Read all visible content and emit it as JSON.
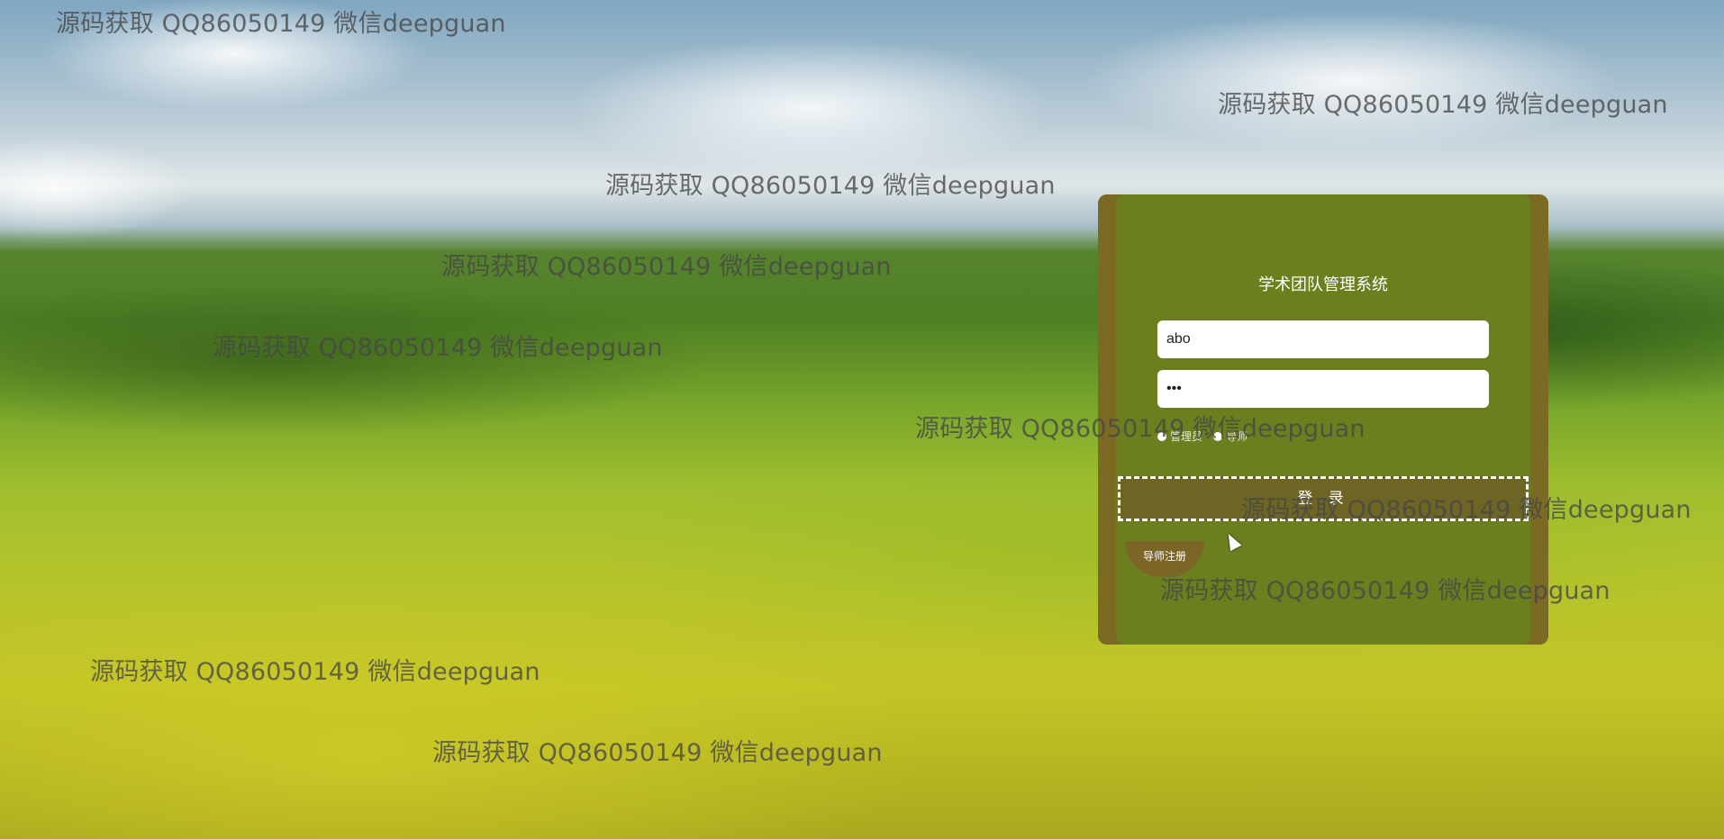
{
  "login": {
    "title": "学术团队管理系统",
    "username_value": "abo",
    "password_value": "•••",
    "roles": [
      "管理员",
      "导师"
    ],
    "login_label": "登 录",
    "register_label": "导师注册"
  },
  "watermarks": [
    "源码获取 QQ86050149 微信deepguan",
    "源码获取 QQ86050149 微信deepguan",
    "源码获取 QQ86050149 微信deepguan",
    "源码获取 QQ86050149 微信deepguan",
    "源码获取 QQ86050149 微信deepguan",
    "源码获取 QQ86050149 微信deepguan",
    "源码获取 QQ86050149 微信deepguan",
    "源码获取 QQ86050149 微信deepguan",
    "源码获取 QQ86050149 微信deepguan",
    "源码获取 QQ86050149 微信deepguan"
  ],
  "colors": {
    "panel": "#6b7f1e",
    "panel_edge": "#7a6a24",
    "button": "#6e6525"
  },
  "icons": [
    "mouse-pointer-icon",
    "radio-icon"
  ]
}
